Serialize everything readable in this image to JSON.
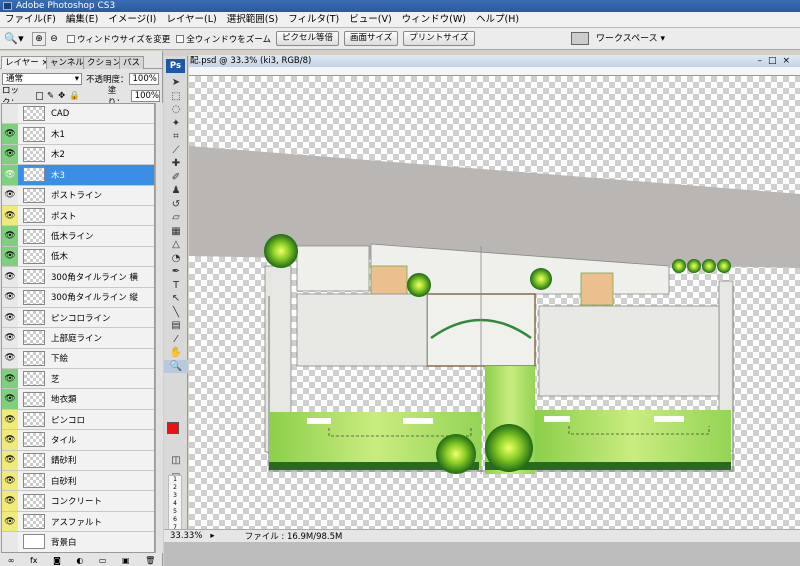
{
  "window": {
    "title": "Adobe Photoshop CS3"
  },
  "menu": [
    "ファイル(F)",
    "編集(E)",
    "イメージ(I)",
    "レイヤー(L)",
    "選択範囲(S)",
    "フィルタ(T)",
    "ビュー(V)",
    "ウィンドウ(W)",
    "ヘルプ(H)"
  ],
  "options": {
    "resize_windows": "ウィンドウサイズを変更",
    "zoom_all": "全ウィンドウをズーム",
    "actual_pixels": "ピクセル等倍",
    "fit_screen": "画面サイズ",
    "print_size": "プリントサイズ",
    "workspace": "ワークスペース ▾"
  },
  "layers_panel": {
    "tabs": [
      "レイヤー ×",
      "ャンネル",
      "クション",
      "パス"
    ],
    "blend_mode": "通常",
    "opacity_label": "不透明度：",
    "opacity_value": "100%",
    "lock_label": "ロック：",
    "fill_label": "塗り：",
    "fill_value": "100%",
    "layers": [
      {
        "name": "CAD",
        "visible": false,
        "color": "none"
      },
      {
        "name": "木1",
        "visible": true,
        "color": "green"
      },
      {
        "name": "木2",
        "visible": true,
        "color": "green"
      },
      {
        "name": "木3",
        "visible": true,
        "color": "green",
        "selected": true
      },
      {
        "name": "ポストライン",
        "visible": true,
        "color": "none"
      },
      {
        "name": "ポスト",
        "visible": true,
        "color": "yellow"
      },
      {
        "name": "低木ライン",
        "visible": true,
        "color": "green"
      },
      {
        "name": "低木",
        "visible": true,
        "color": "green"
      },
      {
        "name": "300角タイルライン  横",
        "visible": true,
        "color": "none"
      },
      {
        "name": "300角タイルライン  縦",
        "visible": true,
        "color": "none"
      },
      {
        "name": "ピンコロライン",
        "visible": true,
        "color": "none"
      },
      {
        "name": "上部庭ライン",
        "visible": true,
        "color": "none"
      },
      {
        "name": "下絵",
        "visible": true,
        "color": "none"
      },
      {
        "name": "芝",
        "visible": true,
        "color": "green"
      },
      {
        "name": "地衣類",
        "visible": true,
        "color": "green"
      },
      {
        "name": "ピンコロ",
        "visible": true,
        "color": "yellow"
      },
      {
        "name": "タイル",
        "visible": true,
        "color": "yellow"
      },
      {
        "name": "錆砂利",
        "visible": true,
        "color": "yellow"
      },
      {
        "name": "白砂利",
        "visible": true,
        "color": "yellow"
      },
      {
        "name": "コンクリート",
        "visible": true,
        "color": "yellow"
      },
      {
        "name": "アスファルト",
        "visible": true,
        "color": "yellow"
      },
      {
        "name": "背景白",
        "visible": false,
        "color": "none",
        "white": true
      }
    ]
  },
  "toolbox": {
    "logo": "Ps"
  },
  "document": {
    "title": "配.psd @ 33.3% (ki3, RGB/8)"
  },
  "status": {
    "zoom": "33.33%",
    "file": "ファイル : 16.9M/98.5M"
  },
  "colors": {
    "foreground": "#ee1111",
    "background": "#ffffff",
    "selection": "#3a8ee6"
  }
}
